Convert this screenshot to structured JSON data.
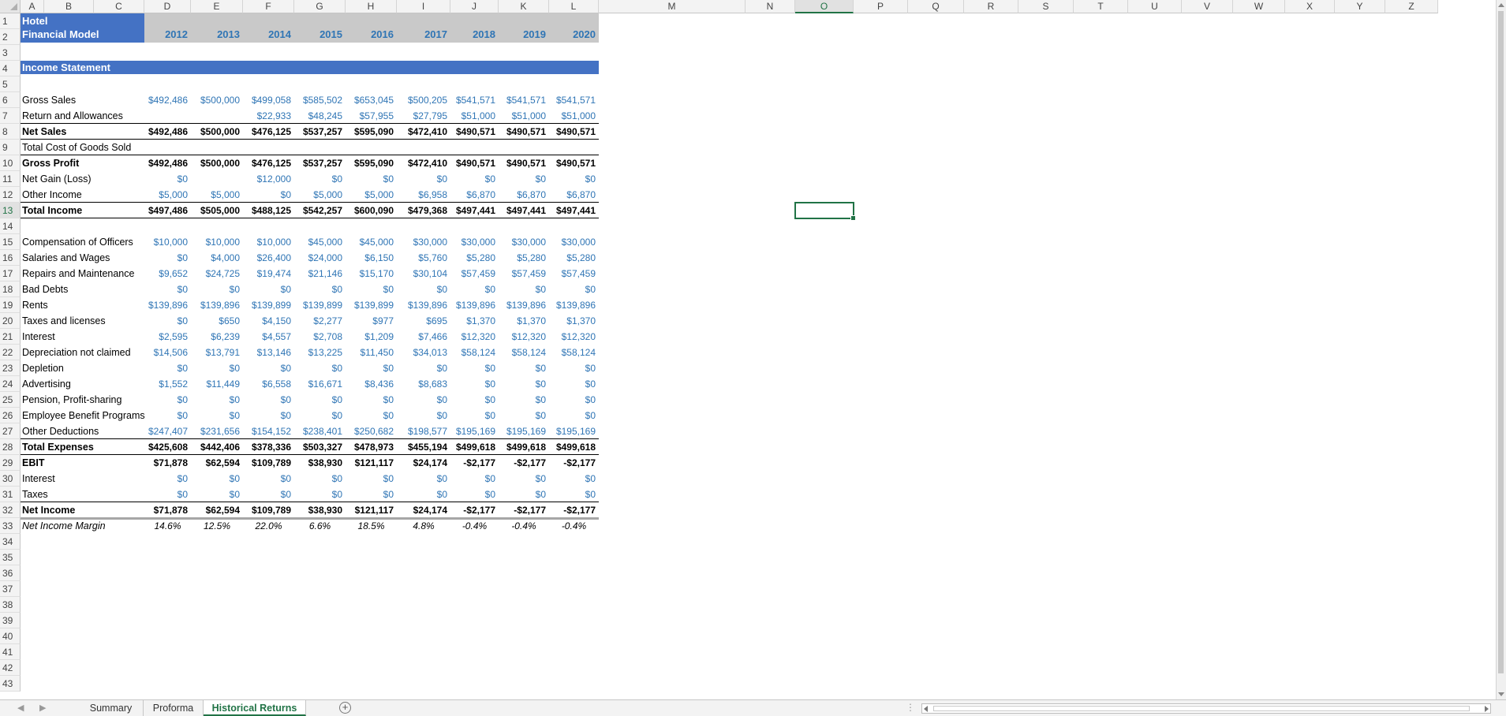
{
  "columns": [
    "A",
    "B",
    "C",
    "D",
    "E",
    "F",
    "G",
    "H",
    "I",
    "J",
    "K",
    "L",
    "M",
    "N",
    "O",
    "P",
    "Q",
    "R",
    "S",
    "T",
    "U",
    "V",
    "W",
    "X",
    "Y",
    "Z"
  ],
  "selected_column": "O",
  "selected_row": 13,
  "title_line1": "Hotel",
  "title_line2": "Financial Model",
  "years": [
    "2012",
    "2013",
    "2014",
    "2015",
    "2016",
    "2017",
    "2018",
    "2019",
    "2020"
  ],
  "section_label": "Income Statement",
  "rows": [
    {
      "row": 6,
      "label": "Gross Sales",
      "values": [
        "$492,486",
        "$500,000",
        "$499,058",
        "$585,502",
        "$653,045",
        "$500,205",
        "$541,571",
        "$541,571",
        "$541,571"
      ]
    },
    {
      "row": 7,
      "label": "Return and Allowances",
      "values": [
        "",
        "",
        "$22,933",
        "$48,245",
        "$57,955",
        "$27,795",
        "$51,000",
        "$51,000",
        "$51,000"
      ]
    },
    {
      "row": 8,
      "label": "Net Sales",
      "bold": true,
      "values": [
        "$492,486",
        "$500,000",
        "$476,125",
        "$537,257",
        "$595,090",
        "$472,410",
        "$490,571",
        "$490,571",
        "$490,571"
      ]
    },
    {
      "row": 9,
      "label": "Total Cost of Goods Sold",
      "values": [
        "",
        "",
        "",
        "",
        "",
        "",
        "",
        "",
        ""
      ]
    },
    {
      "row": 10,
      "label": "Gross Profit",
      "bold": true,
      "values": [
        "$492,486",
        "$500,000",
        "$476,125",
        "$537,257",
        "$595,090",
        "$472,410",
        "$490,571",
        "$490,571",
        "$490,571"
      ]
    },
    {
      "row": 11,
      "label": "Net Gain (Loss)",
      "values": [
        "$0",
        "",
        "$12,000",
        "$0",
        "$0",
        "$0",
        "$0",
        "$0",
        "$0"
      ]
    },
    {
      "row": 12,
      "label": "Other Income",
      "values": [
        "$5,000",
        "$5,000",
        "$0",
        "$5,000",
        "$5,000",
        "$6,958",
        "$6,870",
        "$6,870",
        "$6,870"
      ]
    },
    {
      "row": 13,
      "label": "Total Income",
      "bold": true,
      "values": [
        "$497,486",
        "$505,000",
        "$488,125",
        "$542,257",
        "$600,090",
        "$479,368",
        "$497,441",
        "$497,441",
        "$497,441"
      ]
    },
    {
      "row": 15,
      "label": "Compensation of Officers",
      "values": [
        "$10,000",
        "$10,000",
        "$10,000",
        "$45,000",
        "$45,000",
        "$30,000",
        "$30,000",
        "$30,000",
        "$30,000"
      ]
    },
    {
      "row": 16,
      "label": "Salaries and Wages",
      "values": [
        "$0",
        "$4,000",
        "$26,400",
        "$24,000",
        "$6,150",
        "$5,760",
        "$5,280",
        "$5,280",
        "$5,280"
      ]
    },
    {
      "row": 17,
      "label": "Repairs and Maintenance",
      "values": [
        "$9,652",
        "$24,725",
        "$19,474",
        "$21,146",
        "$15,170",
        "$30,104",
        "$57,459",
        "$57,459",
        "$57,459"
      ]
    },
    {
      "row": 18,
      "label": "Bad Debts",
      "values": [
        "$0",
        "$0",
        "$0",
        "$0",
        "$0",
        "$0",
        "$0",
        "$0",
        "$0"
      ]
    },
    {
      "row": 19,
      "label": "Rents",
      "values": [
        "$139,896",
        "$139,896",
        "$139,899",
        "$139,899",
        "$139,899",
        "$139,896",
        "$139,896",
        "$139,896",
        "$139,896"
      ]
    },
    {
      "row": 20,
      "label": "Taxes and licenses",
      "values": [
        "$0",
        "$650",
        "$4,150",
        "$2,277",
        "$977",
        "$695",
        "$1,370",
        "$1,370",
        "$1,370"
      ]
    },
    {
      "row": 21,
      "label": "Interest",
      "values": [
        "$2,595",
        "$6,239",
        "$4,557",
        "$2,708",
        "$1,209",
        "$7,466",
        "$12,320",
        "$12,320",
        "$12,320"
      ]
    },
    {
      "row": 22,
      "label": "Depreciation not claimed",
      "values": [
        "$14,506",
        "$13,791",
        "$13,146",
        "$13,225",
        "$11,450",
        "$34,013",
        "$58,124",
        "$58,124",
        "$58,124"
      ]
    },
    {
      "row": 23,
      "label": "Depletion",
      "values": [
        "$0",
        "$0",
        "$0",
        "$0",
        "$0",
        "$0",
        "$0",
        "$0",
        "$0"
      ]
    },
    {
      "row": 24,
      "label": "Advertising",
      "values": [
        "$1,552",
        "$11,449",
        "$6,558",
        "$16,671",
        "$8,436",
        "$8,683",
        "$0",
        "$0",
        "$0"
      ]
    },
    {
      "row": 25,
      "label": "Pension, Profit-sharing",
      "values": [
        "$0",
        "$0",
        "$0",
        "$0",
        "$0",
        "$0",
        "$0",
        "$0",
        "$0"
      ]
    },
    {
      "row": 26,
      "label": "Employee Benefit Programs",
      "values": [
        "$0",
        "$0",
        "$0",
        "$0",
        "$0",
        "$0",
        "$0",
        "$0",
        "$0"
      ]
    },
    {
      "row": 27,
      "label": "Other Deductions",
      "values": [
        "$247,407",
        "$231,656",
        "$154,152",
        "$238,401",
        "$250,682",
        "$198,577",
        "$195,169",
        "$195,169",
        "$195,169"
      ]
    },
    {
      "row": 28,
      "label": "Total Expenses",
      "bold": true,
      "values": [
        "$425,608",
        "$442,406",
        "$378,336",
        "$503,327",
        "$478,973",
        "$455,194",
        "$499,618",
        "$499,618",
        "$499,618"
      ]
    },
    {
      "row": 29,
      "label": "EBIT",
      "bold": true,
      "values": [
        "$71,878",
        "$62,594",
        "$109,789",
        "$38,930",
        "$121,117",
        "$24,174",
        "-$2,177",
        "-$2,177",
        "-$2,177"
      ]
    },
    {
      "row": 30,
      "label": "Interest",
      "values": [
        "$0",
        "$0",
        "$0",
        "$0",
        "$0",
        "$0",
        "$0",
        "$0",
        "$0"
      ]
    },
    {
      "row": 31,
      "label": "Taxes",
      "values": [
        "$0",
        "$0",
        "$0",
        "$0",
        "$0",
        "$0",
        "$0",
        "$0",
        "$0"
      ]
    },
    {
      "row": 32,
      "label": "Net Income",
      "bold": true,
      "values": [
        "$71,878",
        "$62,594",
        "$109,789",
        "$38,930",
        "$121,117",
        "$24,174",
        "-$2,177",
        "-$2,177",
        "-$2,177"
      ]
    },
    {
      "row": 33,
      "label": "Net Income Margin",
      "italic": true,
      "pct": true,
      "values": [
        "14.6%",
        "12.5%",
        "22.0%",
        "6.6%",
        "18.5%",
        "4.8%",
        "-0.4%",
        "-0.4%",
        "-0.4%"
      ]
    }
  ],
  "sheet_tabs": [
    {
      "label": "Summary",
      "active": false
    },
    {
      "label": "Proforma",
      "active": false
    },
    {
      "label": "Historical Returns",
      "active": true
    }
  ],
  "colors": {
    "header_band": "#4472c4",
    "year_band": "#c9c9c9",
    "value_blue": "#2f75b5",
    "excel_green": "#217346"
  }
}
